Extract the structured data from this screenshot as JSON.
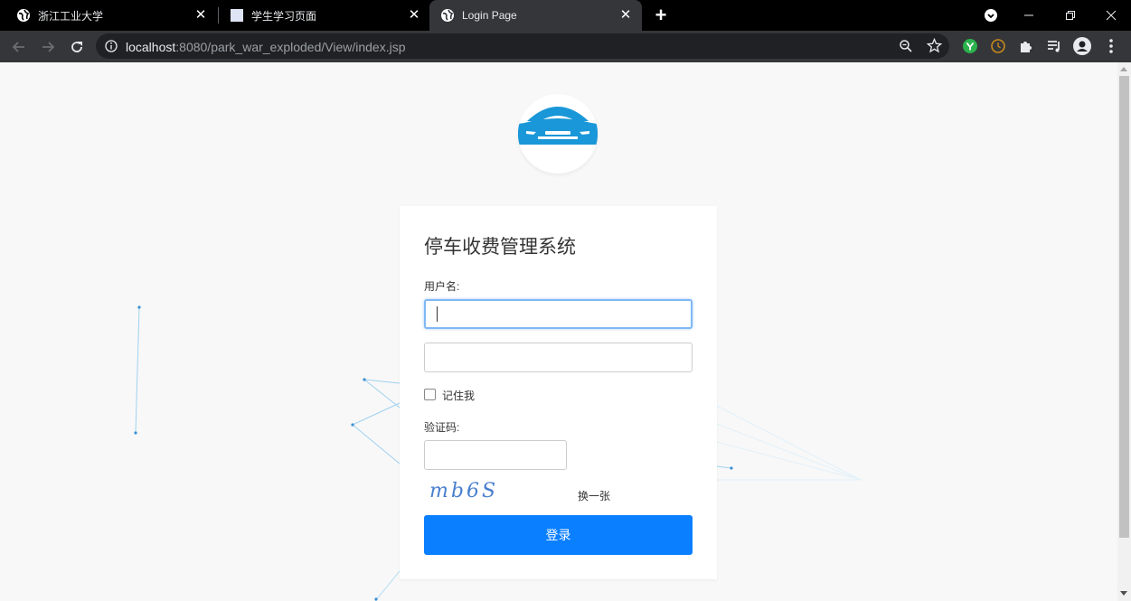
{
  "browser": {
    "tabs": [
      {
        "title": "浙江工业大学",
        "favicon": "globe-icon",
        "active": false
      },
      {
        "title": "学生学习页面",
        "favicon": "blank-page-icon",
        "active": false
      },
      {
        "title": "Login Page",
        "favicon": "globe-icon",
        "active": true
      }
    ],
    "url_host": "localhost",
    "url_rest": ":8080/park_war_exploded/View/index.jsp"
  },
  "login": {
    "title": "停车收费管理系统",
    "username_label": "用户名:",
    "username_value": "",
    "password_value": "",
    "remember_label": "记住我",
    "captcha_label": "验证码:",
    "captcha_value": "",
    "captcha_text": "mb6S",
    "refresh_label": "换一张",
    "submit_label": "登录"
  },
  "colors": {
    "primary": "#0a7fff",
    "logo_blue": "#1a97d8",
    "page_bg": "#f8f8f8"
  }
}
